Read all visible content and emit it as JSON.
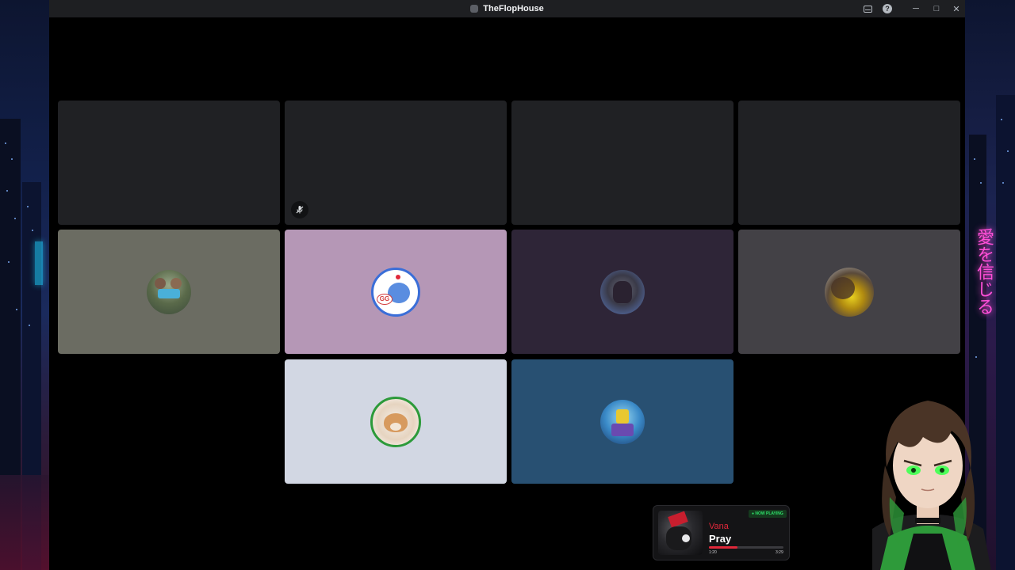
{
  "window": {
    "title": "TheFlopHouse",
    "controls": {
      "minimize": "─",
      "maximize": "□",
      "close": "✕"
    }
  },
  "tiles": [
    {
      "kind": "empty"
    },
    {
      "kind": "empty",
      "muted": true
    },
    {
      "kind": "empty"
    },
    {
      "kind": "empty"
    },
    {
      "kind": "avatar",
      "bg": "#6b6c62"
    },
    {
      "kind": "avatar",
      "bg": "#b597b6"
    },
    {
      "kind": "avatar",
      "bg": "#2e2537"
    },
    {
      "kind": "avatar",
      "bg": "#434146"
    },
    {
      "kind": "avatar",
      "bg": "#d2d7e3"
    },
    {
      "kind": "avatar",
      "bg": "#285072"
    }
  ],
  "now_playing": {
    "badge": "● NOW PLAYING",
    "artist": "Vana",
    "title": "Pray",
    "elapsed": "1:20",
    "duration": "3:29",
    "progress": 0.38
  },
  "colors": {
    "accent_red": "#e0283a",
    "now_playing_green": "#2ee26a",
    "neon_pink": "#ff4fd8"
  },
  "backdrop": {
    "neon_sign": "愛を信じる"
  }
}
